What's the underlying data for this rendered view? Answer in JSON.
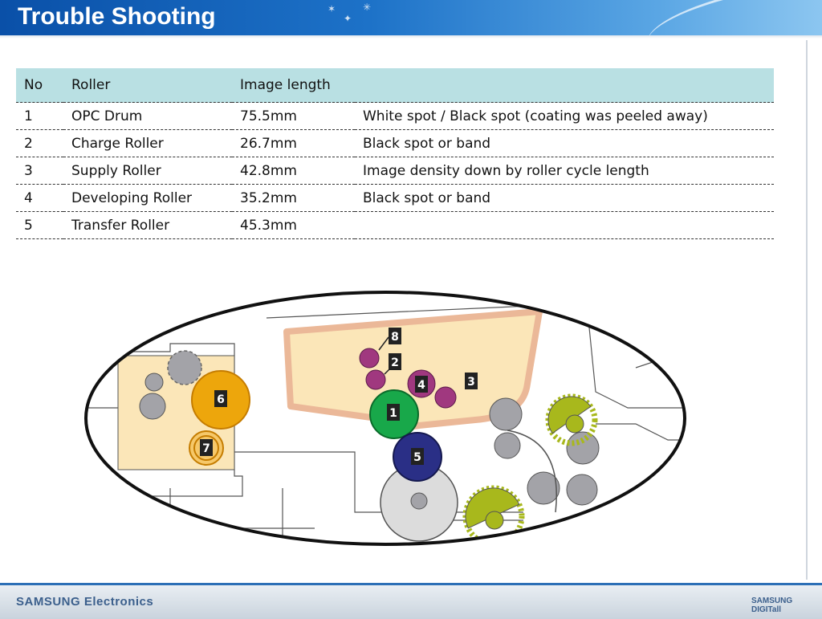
{
  "header": {
    "title": "Trouble Shooting"
  },
  "table": {
    "headers": [
      "No",
      "Roller",
      "Image length",
      ""
    ],
    "rows": [
      [
        "1",
        "OPC Drum",
        "75.5mm",
        "White spot  /  Black spot (coating was peeled away)"
      ],
      [
        "2",
        "Charge Roller",
        "26.7mm",
        "Black spot or band"
      ],
      [
        "3",
        "Supply Roller",
        "42.8mm",
        "Image density down by roller cycle length"
      ],
      [
        "4",
        "Developing Roller",
        "35.2mm",
        "Black spot or band"
      ],
      [
        "5",
        "Transfer Roller",
        "45.3mm",
        ""
      ]
    ]
  },
  "diagram": {
    "labels": [
      "8",
      "2",
      "4",
      "3",
      "1",
      "5",
      "6",
      "7"
    ],
    "colors": {
      "cartridge": "#fbe6b8",
      "magenta_roller": "#a0387f",
      "opc_drum": "#18a84a",
      "transfer_roller": "#2a2f86",
      "fuser_roller": "#eda60c",
      "gear": "#a8b81c",
      "grey_roller": "#a3a3a8"
    }
  },
  "footer": {
    "brand": "SAMSUNG Electronics",
    "logo": "SAMSUNG DIGITall"
  }
}
